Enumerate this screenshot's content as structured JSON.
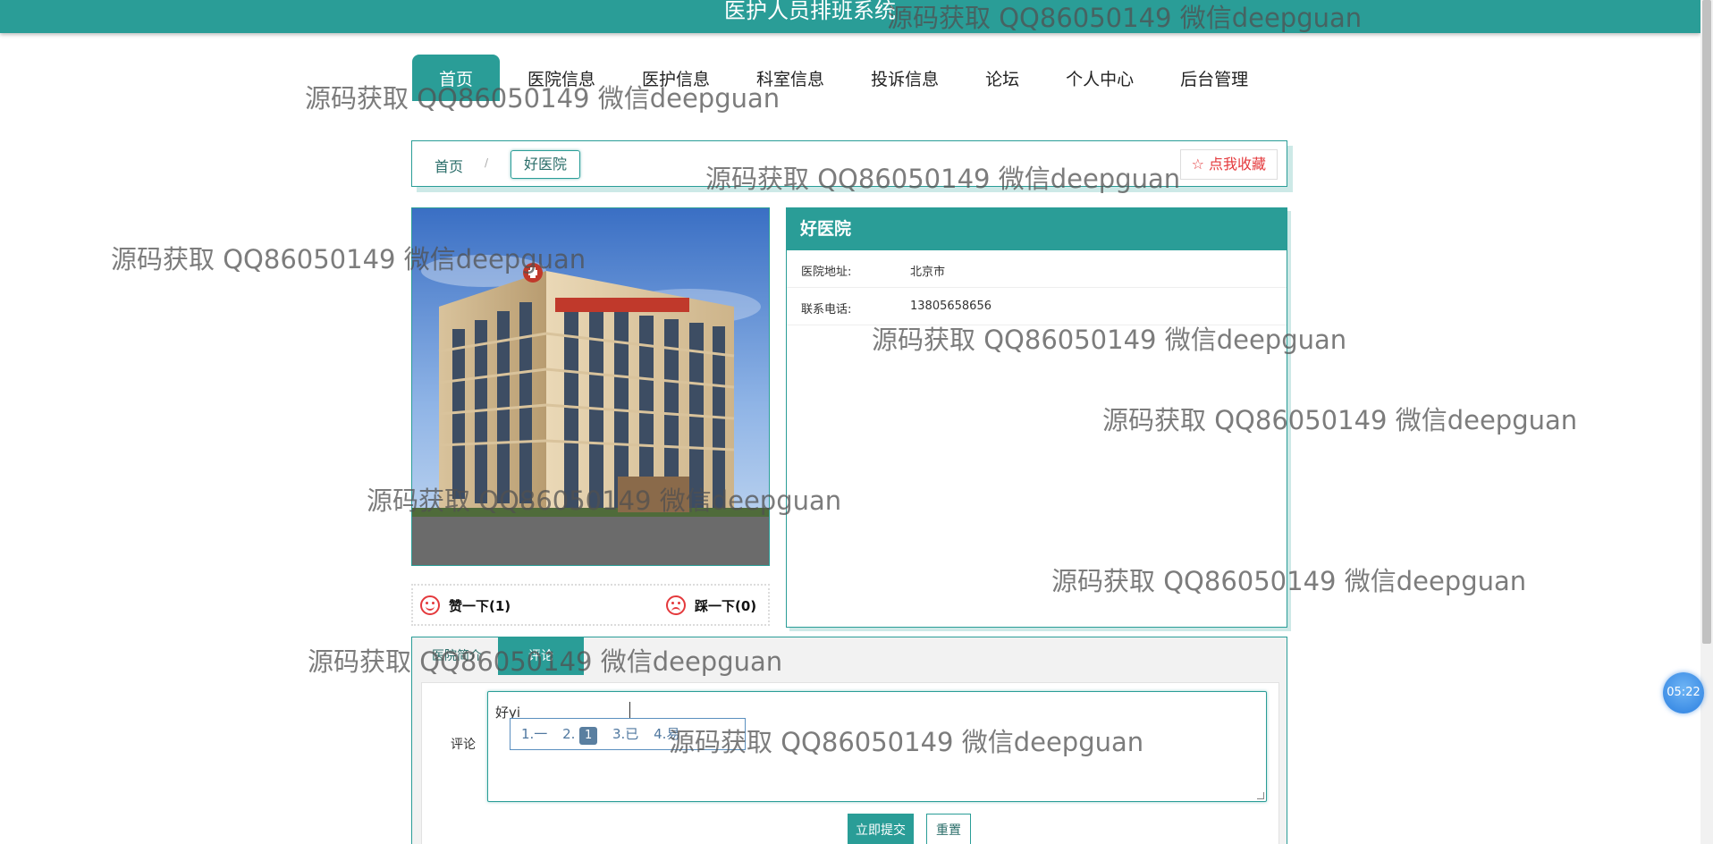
{
  "header": {
    "title": "医护人员排班系统"
  },
  "nav": {
    "items": [
      {
        "label": "首页",
        "active": true
      },
      {
        "label": "医院信息"
      },
      {
        "label": "医护信息"
      },
      {
        "label": "科室信息"
      },
      {
        "label": "投诉信息"
      },
      {
        "label": "论坛"
      },
      {
        "label": "个人中心"
      },
      {
        "label": "后台管理"
      }
    ]
  },
  "breadcrumb": {
    "home": "首页",
    "separator": "/",
    "current": "好医院"
  },
  "favorite": {
    "icon": "star-outline-icon",
    "label": "☆ 点我收藏"
  },
  "hospital": {
    "name": "好医院",
    "fields": [
      {
        "key": "医院地址:",
        "value": "北京市"
      },
      {
        "key": "联系电话:",
        "value": "13805658656"
      }
    ]
  },
  "votes": {
    "like": {
      "icon": "smile-face-icon",
      "label": "赞一下(1)"
    },
    "dislike": {
      "icon": "sad-face-icon",
      "label": "踩一下(0)"
    }
  },
  "tabs": [
    {
      "label": "医院简介",
      "active": false
    },
    {
      "label": "评论",
      "active": true
    }
  ],
  "comment_form": {
    "label": "评论",
    "value": "好yi",
    "ime_candidates": [
      "1.一",
      "2.",
      "1",
      "3.已",
      "4.易"
    ],
    "submit_label": "立即提交",
    "reset_label": "重置"
  },
  "clock": {
    "time": "05:22"
  },
  "watermark": "源码获取 QQ86050149 微信deepguan",
  "colors": {
    "primary": "#2a9d97",
    "accent": "#e4393c"
  }
}
